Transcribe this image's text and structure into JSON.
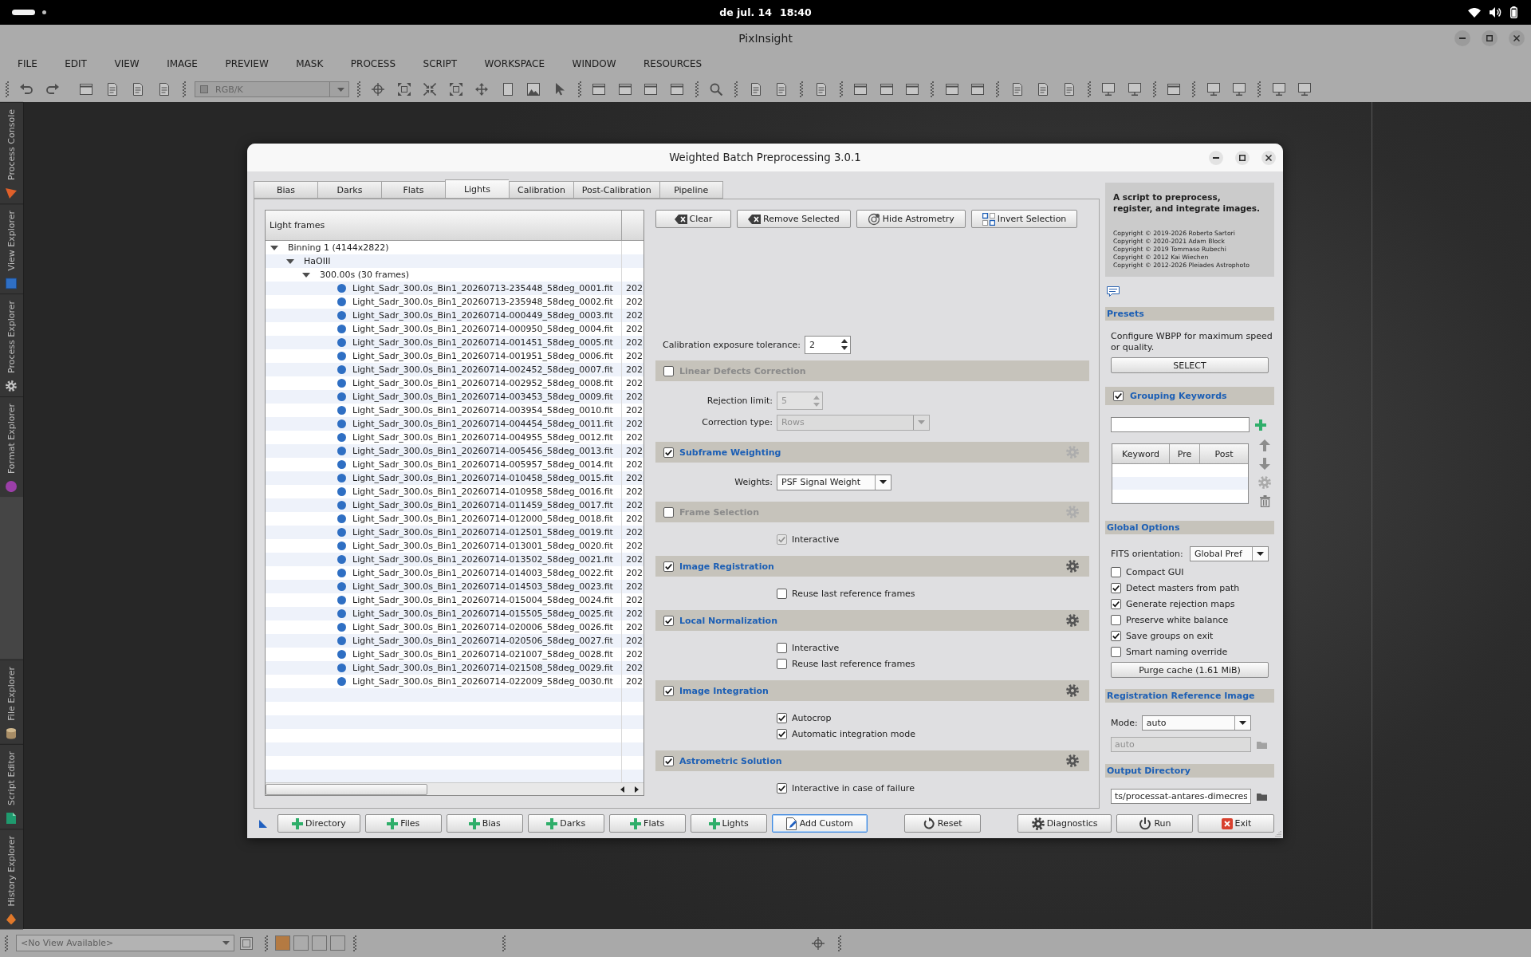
{
  "top_bar": {
    "date": "de jul. 14",
    "time": "18:40"
  },
  "app_window": {
    "title": "PixInsight",
    "menu": [
      "FILE",
      "EDIT",
      "VIEW",
      "IMAGE",
      "PREVIEW",
      "MASK",
      "PROCESS",
      "SCRIPT",
      "WORKSPACE",
      "WINDOW",
      "RESOURCES"
    ]
  },
  "toolbar": {
    "view_mode": {
      "value": "RGB/K",
      "disabled": true
    }
  },
  "side_panel": {
    "top_tabs": [
      {
        "label": "Process Console"
      },
      {
        "label": "View Explorer"
      },
      {
        "label": "Process Explorer"
      },
      {
        "label": "Format Explorer"
      }
    ],
    "bottom_tabs": [
      {
        "label": "File Explorer"
      },
      {
        "label": "Script Editor"
      },
      {
        "label": "History Explorer"
      }
    ]
  },
  "dialog": {
    "title": "Weighted Batch Preprocessing 3.0.1",
    "tabs": [
      {
        "label": "Bias",
        "selected": false
      },
      {
        "label": "Darks",
        "selected": false
      },
      {
        "label": "Flats",
        "selected": false
      },
      {
        "label": "Lights",
        "selected": true
      },
      {
        "label": "Calibration",
        "selected": false
      },
      {
        "label": "Post-Calibration",
        "selected": false
      },
      {
        "label": "Pipeline",
        "selected": false
      }
    ],
    "light_frames": {
      "header": "Light frames",
      "nodes": [
        {
          "label": "Binning 1 (4144x2822)",
          "expanded": true,
          "children": [
            {
              "label": "HaOIII",
              "expanded": true,
              "children": [
                {
                  "label": "300.00s (30 frames)",
                  "expanded": true,
                  "children": [
                    {
                      "label": "Light_Sadr_300.0s_Bin1_20260713-235448_58deg_0001.fit",
                      "column_2": "202"
                    },
                    {
                      "label": "Light_Sadr_300.0s_Bin1_20260713-235948_58deg_0002.fit",
                      "column_2": "202"
                    },
                    {
                      "label": "Light_Sadr_300.0s_Bin1_20260714-000449_58deg_0003.fit",
                      "column_2": "202"
                    },
                    {
                      "label": "Light_Sadr_300.0s_Bin1_20260714-000950_58deg_0004.fit",
                      "column_2": "202"
                    },
                    {
                      "label": "Light_Sadr_300.0s_Bin1_20260714-001451_58deg_0005.fit",
                      "column_2": "202"
                    },
                    {
                      "label": "Light_Sadr_300.0s_Bin1_20260714-001951_58deg_0006.fit",
                      "column_2": "202"
                    },
                    {
                      "label": "Light_Sadr_300.0s_Bin1_20260714-002452_58deg_0007.fit",
                      "column_2": "202"
                    },
                    {
                      "label": "Light_Sadr_300.0s_Bin1_20260714-002952_58deg_0008.fit",
                      "column_2": "202"
                    },
                    {
                      "label": "Light_Sadr_300.0s_Bin1_20260714-003453_58deg_0009.fit",
                      "column_2": "202"
                    },
                    {
                      "label": "Light_Sadr_300.0s_Bin1_20260714-003954_58deg_0010.fit",
                      "column_2": "202"
                    },
                    {
                      "label": "Light_Sadr_300.0s_Bin1_20260714-004454_58deg_0011.fit",
                      "column_2": "202"
                    },
                    {
                      "label": "Light_Sadr_300.0s_Bin1_20260714-004955_58deg_0012.fit",
                      "column_2": "202"
                    },
                    {
                      "label": "Light_Sadr_300.0s_Bin1_20260714-005456_58deg_0013.fit",
                      "column_2": "202"
                    },
                    {
                      "label": "Light_Sadr_300.0s_Bin1_20260714-005957_58deg_0014.fit",
                      "column_2": "202"
                    },
                    {
                      "label": "Light_Sadr_300.0s_Bin1_20260714-010458_58deg_0015.fit",
                      "column_2": "202"
                    },
                    {
                      "label": "Light_Sadr_300.0s_Bin1_20260714-010958_58deg_0016.fit",
                      "column_2": "202"
                    },
                    {
                      "label": "Light_Sadr_300.0s_Bin1_20260714-011459_58deg_0017.fit",
                      "column_2": "202"
                    },
                    {
                      "label": "Light_Sadr_300.0s_Bin1_20260714-012000_58deg_0018.fit",
                      "column_2": "202"
                    },
                    {
                      "label": "Light_Sadr_300.0s_Bin1_20260714-012501_58deg_0019.fit",
                      "column_2": "202"
                    },
                    {
                      "label": "Light_Sadr_300.0s_Bin1_20260714-013001_58deg_0020.fit",
                      "column_2": "202"
                    },
                    {
                      "label": "Light_Sadr_300.0s_Bin1_20260714-013502_58deg_0021.fit",
                      "column_2": "202"
                    },
                    {
                      "label": "Light_Sadr_300.0s_Bin1_20260714-014003_58deg_0022.fit",
                      "column_2": "202"
                    },
                    {
                      "label": "Light_Sadr_300.0s_Bin1_20260714-014503_58deg_0023.fit",
                      "column_2": "202"
                    },
                    {
                      "label": "Light_Sadr_300.0s_Bin1_20260714-015004_58deg_0024.fit",
                      "column_2": "202"
                    },
                    {
                      "label": "Light_Sadr_300.0s_Bin1_20260714-015505_58deg_0025.fit",
                      "column_2": "202"
                    },
                    {
                      "label": "Light_Sadr_300.0s_Bin1_20260714-020006_58deg_0026.fit",
                      "column_2": "202"
                    },
                    {
                      "label": "Light_Sadr_300.0s_Bin1_20260714-020506_58deg_0027.fit",
                      "column_2": "202"
                    },
                    {
                      "label": "Light_Sadr_300.0s_Bin1_20260714-021007_58deg_0028.fit",
                      "column_2": "202"
                    },
                    {
                      "label": "Light_Sadr_300.0s_Bin1_20260714-021508_58deg_0029.fit",
                      "column_2": "202"
                    },
                    {
                      "label": "Light_Sadr_300.0s_Bin1_20260714-022009_58deg_0030.fit",
                      "column_2": "202"
                    }
                  ]
                }
              ]
            }
          ]
        }
      ]
    },
    "actions": [
      {
        "kind": "clear",
        "label": "Clear"
      },
      {
        "kind": "remove",
        "label": "Remove Selected"
      },
      {
        "kind": "astrometry",
        "label": "Hide Astrometry"
      },
      {
        "kind": "invert",
        "label": "Invert Selection"
      }
    ],
    "exposure_tolerance": {
      "label": "Calibration exposure tolerance:",
      "value": "2"
    },
    "sections": [
      {
        "title": "Linear Defects Correction",
        "checked": false,
        "rows": [
          {
            "kind": "spin",
            "label": "Rejection limit:",
            "value": "5",
            "disabled": true
          },
          {
            "kind": "combo",
            "label": "Correction type:",
            "value": "Rows",
            "disabled": true
          }
        ]
      },
      {
        "title": "Subframe Weighting",
        "checked": true,
        "settings": {
          "disabled": true
        },
        "rows": [
          {
            "kind": "combo",
            "label": "Weights:",
            "value": "PSF Signal Weight",
            "disabled": false
          }
        ]
      },
      {
        "title": "Frame Selection",
        "checked": false,
        "settings": {
          "disabled": true
        },
        "rows": [
          {
            "kind": "checkbox",
            "label": "Interactive",
            "checked": true,
            "disabled": true
          }
        ]
      },
      {
        "title": "Image Registration",
        "checked": true,
        "settings": {
          "disabled": false
        },
        "rows": [
          {
            "kind": "checkbox",
            "label": "Reuse last reference frames",
            "checked": false,
            "disabled": false
          }
        ]
      },
      {
        "title": "Local Normalization",
        "checked": true,
        "settings": {
          "disabled": false
        },
        "rows": [
          {
            "kind": "checkbox",
            "label": "Interactive",
            "checked": false,
            "disabled": false
          },
          {
            "kind": "checkbox",
            "label": "Reuse last reference frames",
            "checked": false,
            "disabled": false
          }
        ]
      },
      {
        "title": "Image Integration",
        "checked": true,
        "settings": {
          "disabled": false
        },
        "rows": [
          {
            "kind": "checkbox",
            "label": "Autocrop",
            "checked": true,
            "disabled": false
          },
          {
            "kind": "checkbox",
            "label": "Automatic integration mode",
            "checked": true,
            "disabled": false
          }
        ]
      },
      {
        "title": "Astrometric Solution",
        "checked": true,
        "settings": {
          "disabled": false
        },
        "rows": [
          {
            "kind": "checkbox",
            "label": "Interactive in case of failure",
            "checked": true,
            "disabled": false
          }
        ]
      }
    ],
    "about": {
      "heading": "A script to preprocess, register, and integrate images.",
      "credits": [
        "Copyright © 2019-2026 Roberto Sartori",
        "Copyright © 2020-2021 Adam Block",
        "Copyright © 2019 Tommaso Rubechi",
        "Copyright © 2012 Kai Wiechen",
        "Copyright © 2012-2026 Pleiades Astrophoto"
      ]
    },
    "presets": {
      "title": "Presets",
      "description": "Configure WBPP for maximum speed or quality.",
      "button": "SELECT"
    },
    "grouping_keywords": {
      "title": "Grouping Keywords",
      "checked": true,
      "columns": [
        "Keyword",
        "Pre",
        "Post"
      ]
    },
    "global_options": {
      "title": "Global Options",
      "fits_orientation": {
        "label": "FITS orientation:",
        "value": "Global Pref"
      },
      "options": [
        {
          "label": "Compact GUI",
          "checked": false
        },
        {
          "label": "Detect masters from path",
          "checked": true
        },
        {
          "label": "Generate rejection maps",
          "checked": true
        },
        {
          "label": "Preserve white balance",
          "checked": false
        },
        {
          "label": "Save groups on exit",
          "checked": true
        },
        {
          "label": "Smart naming override",
          "checked": false
        }
      ],
      "purge_button": "Purge cache (1.61 MiB)"
    },
    "registration_reference_image": {
      "title": "Registration Reference Image",
      "mode": {
        "label": "Mode:",
        "value": "auto"
      },
      "reference": {
        "value": "auto",
        "disabled": true
      }
    },
    "output_directory": {
      "title": "Output Directory",
      "value": "ts/processat-antares-dimecres"
    },
    "footer": [
      {
        "buttons": [
          {
            "kind": "add",
            "label": "Directory",
            "focused": false
          },
          {
            "kind": "add",
            "label": "Files",
            "focused": false
          },
          {
            "kind": "add",
            "label": "Bias",
            "focused": false
          },
          {
            "kind": "add",
            "label": "Darks",
            "focused": false
          },
          {
            "kind": "add",
            "label": "Flats",
            "focused": false
          },
          {
            "kind": "add",
            "label": "Lights",
            "focused": false
          },
          {
            "kind": "custom",
            "label": "Add Custom",
            "focused": true
          }
        ]
      },
      {
        "buttons": [
          {
            "kind": "reset",
            "label": "Reset",
            "focused": false
          }
        ]
      },
      {
        "buttons": [
          {
            "kind": "diagnostics",
            "label": "Diagnostics",
            "focused": false
          },
          {
            "kind": "run",
            "label": "Run",
            "focused": false
          },
          {
            "kind": "exit",
            "label": "Exit",
            "focused": false
          }
        ]
      }
    ]
  },
  "status_bar": {
    "view_selector": {
      "value": "<No View Available>",
      "disabled": true
    },
    "swatches": [
      {
        "color": "#b47a42"
      },
      {
        "color": "#ababab"
      },
      {
        "color": "#ababab"
      },
      {
        "color": "#ababab"
      }
    ]
  }
}
